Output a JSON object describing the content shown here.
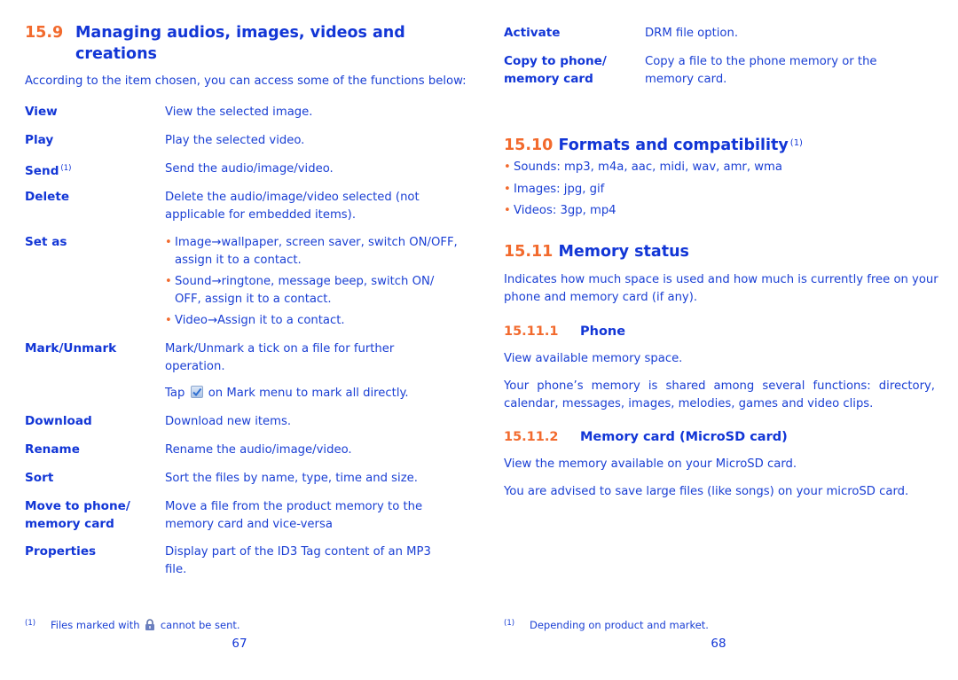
{
  "left_page": {
    "section_number": "15.9",
    "section_title_line1": "Managing audios, images, videos and",
    "section_title_line2": "creations",
    "intro": "According to the item chosen, you can access some of the functions below:",
    "items": [
      {
        "term": "View",
        "def": "View the selected image."
      },
      {
        "term": "Play",
        "def": "Play the selected video."
      },
      {
        "term": "Send",
        "term_sup": "(1)",
        "def": "Send the audio/image/video."
      },
      {
        "term": "Delete",
        "def_line1": "Delete the audio/image/video selected (not",
        "def_line2": "applicable for embedded items)."
      },
      {
        "term": "Set as",
        "bullets": [
          {
            "line1": "Image→wallpaper, screen saver, switch ON/OFF,",
            "line2": "assign it to a contact."
          },
          {
            "line1": "Sound→ringtone, message beep, switch ON/",
            "line2": "OFF, assign it to a contact."
          },
          {
            "line1": "Video→Assign it to a contact."
          }
        ]
      },
      {
        "term": "Mark/Unmark",
        "def_line1": "Mark/Unmark a tick on a file for further",
        "def_line2": "operation.",
        "extra_before_icon": "Tap",
        "extra_after_icon": "on Mark menu to mark all directly.",
        "extra_icon": "checkbox-tick-icon"
      },
      {
        "term": "Download",
        "def": "Download new items."
      },
      {
        "term": "Rename",
        "def": "Rename the audio/image/video."
      },
      {
        "term": "Sort",
        "def": "Sort the files by name, type, time and size."
      },
      {
        "term_line1": "Move to phone/",
        "term_line2": "memory card",
        "def_line1": "Move a file from the product memory to the",
        "def_line2": "memory card and vice-versa"
      },
      {
        "term": "Properties",
        "def_line1": "Display part of the ID3 Tag content of an MP3",
        "def_line2": "file."
      }
    ],
    "footnote_mark": "(1)",
    "footnote_before_icon": "Files marked with",
    "footnote_icon": "lock-icon",
    "footnote_after_icon": "cannot be sent.",
    "page_number": "67"
  },
  "right_page": {
    "items": [
      {
        "term": "Activate",
        "def": "DRM file option."
      },
      {
        "term_line1": "Copy to phone/",
        "term_line2": "memory card",
        "def_line1": "Copy a file to the phone memory or the",
        "def_line2": "memory card."
      }
    ],
    "formats": {
      "section_number": "15.10",
      "section_title": "Formats and compatibility",
      "title_sup": "(1)",
      "bullets": [
        "Sounds: mp3, m4a, aac, midi, wav, amr, wma",
        "Images: jpg, gif",
        "Videos: 3gp, mp4"
      ]
    },
    "memory": {
      "section_number": "15.11",
      "section_title": "Memory status",
      "intro_line1": "Indicates how much space is used and how much is currently free on your",
      "intro_line2": "phone and memory card (if any).",
      "phone": {
        "number": "15.11.1",
        "title": "Phone",
        "p1": "View available memory space.",
        "p2_line1": "Your phone’s memory is shared among several functions: directory,",
        "p2_line2": "calendar, messages, images, melodies, games and video clips."
      },
      "card": {
        "number": "15.11.2",
        "title": "Memory card (MicroSD card)",
        "p1": "View the memory available on your MicroSD card.",
        "p2": "You are advised to save large files (like songs) on your microSD card."
      }
    },
    "footnote_mark": "(1)",
    "footnote": "Depending on product and market.",
    "page_number": "68"
  },
  "colors": {
    "heading_blue": "#1236d6",
    "text_blue": "#1a3fd4",
    "accent_orange": "#f26a2d"
  }
}
